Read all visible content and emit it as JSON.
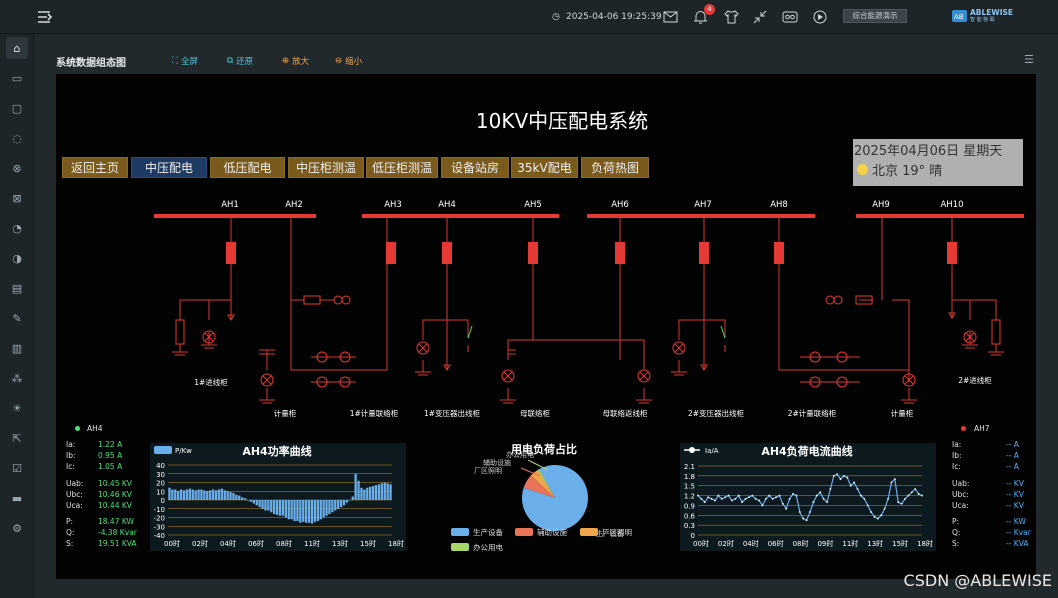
{
  "topbar": {
    "datetime": "2025-04-06 19:25:39",
    "badge": "4",
    "demo_label": "综合能源演示",
    "brand": "ABLEWISE",
    "brand_sub": "智 能 物 联"
  },
  "page": {
    "title": "系统数据组态图",
    "tools": {
      "fullscreen": "全屏",
      "restore": "还原",
      "zoom_in": "放大",
      "zoom_out": "缩小"
    }
  },
  "scada": {
    "title": "10KV中压配电系统",
    "nav": [
      "返回主页",
      "中压配电",
      "低压配电",
      "中压柜测温",
      "低压柜测温",
      "设备站房",
      "35kV配电",
      "负荷热图"
    ],
    "weather": {
      "date": "2025年04月06日 星期天",
      "city_weather": "北京 19° 晴"
    },
    "cabinets": [
      "AH1",
      "AH2",
      "AH3",
      "AH4",
      "AH5",
      "AH6",
      "AH7",
      "AH8",
      "AH9",
      "AH10"
    ],
    "labels": {
      "in1": "1#进线柜",
      "meter1": "计量柜",
      "link1": "1#计量联络柜",
      "tx1": "1#变压器出线柜",
      "bus_tie": "母联络柜",
      "bus_tie_back": "母联络返线柜",
      "tx2": "2#变压器出线柜",
      "link2": "2#计量联络柜",
      "meter2": "计量柜",
      "in2": "2#进线柜"
    }
  },
  "left_meter": {
    "name": "AH4",
    "rows": [
      {
        "k": "Ia:",
        "v": "1.22 A"
      },
      {
        "k": "Ib:",
        "v": "0.95 A"
      },
      {
        "k": "Ic:",
        "v": "1.05 A"
      },
      {
        "k": "Uab:",
        "v": "10.45 KV"
      },
      {
        "k": "Ubc:",
        "v": "10.46 KV"
      },
      {
        "k": "Uca:",
        "v": "10.44 KV"
      },
      {
        "k": "P:",
        "v": "18.47 KW"
      },
      {
        "k": "Q:",
        "v": "-4.38 Kvar"
      },
      {
        "k": "S:",
        "v": "19.51 KVA"
      }
    ]
  },
  "right_meter": {
    "name": "AH7",
    "rows": [
      {
        "k": "Ia:",
        "v": "-- A"
      },
      {
        "k": "Ib:",
        "v": "-- A"
      },
      {
        "k": "Ic:",
        "v": "-- A"
      },
      {
        "k": "Uab:",
        "v": "-- KV"
      },
      {
        "k": "Ubc:",
        "v": "-- KV"
      },
      {
        "k": "Uca:",
        "v": "-- KV"
      },
      {
        "k": "P:",
        "v": "-- KW"
      },
      {
        "k": "Q:",
        "v": "-- Kvar"
      },
      {
        "k": "S:",
        "v": "-- KVA"
      }
    ]
  },
  "chart_data": [
    {
      "type": "bar",
      "title": "AH4功率曲线",
      "legend": "P/Kw",
      "ylim": [
        -40,
        40
      ],
      "yticks": [
        40,
        30,
        20,
        10,
        0,
        -10,
        -20,
        -30,
        -40
      ],
      "xticks": [
        "00时",
        "02时",
        "04时",
        "06时",
        "08时",
        "11时",
        "13时",
        "15时",
        "18时"
      ],
      "values": [
        14,
        12,
        12,
        10,
        12,
        11,
        12,
        13,
        12,
        11,
        12,
        12,
        11,
        10,
        11,
        12,
        11,
        12,
        13,
        11,
        10,
        9,
        8,
        6,
        5,
        3,
        2,
        0,
        -2,
        -4,
        -6,
        -8,
        -10,
        -12,
        -12,
        -14,
        -16,
        -17,
        -18,
        -18,
        -20,
        -22,
        -22,
        -24,
        -24,
        -26,
        -25,
        -26,
        -26,
        -27,
        -25,
        -24,
        -22,
        -20,
        -18,
        -16,
        -14,
        -12,
        -10,
        -8,
        -6,
        -3,
        0,
        4,
        30,
        22,
        14,
        12,
        14,
        15,
        16,
        17,
        18,
        19,
        20,
        19,
        18
      ]
    },
    {
      "type": "pie",
      "title": "用电负荷占比",
      "slices": [
        {
          "name": "生产设备",
          "value": 88,
          "color": "#6aaeea"
        },
        {
          "name": "辅助设施",
          "value": 7,
          "color": "#e8745a"
        },
        {
          "name": "厂区照明",
          "value": 4,
          "color": "#f0a74c"
        },
        {
          "name": "办公用电",
          "value": 1,
          "color": "#a7d66a"
        }
      ]
    },
    {
      "type": "line",
      "title": "AH4负荷电流曲线",
      "legend": "Ia/A",
      "ylim": [
        0,
        2.1
      ],
      "yticks": [
        "2.1",
        "1.8",
        "1.5",
        "1.2",
        "0.9",
        "0.6",
        "0.3",
        "0"
      ],
      "xticks": [
        "00时",
        "02时",
        "04时",
        "06时",
        "08时",
        "09时",
        "11时",
        "13时",
        "15时",
        "18时"
      ],
      "values": [
        1.2,
        1.1,
        1.0,
        1.15,
        1.1,
        1.05,
        1.2,
        1.1,
        1.15,
        1.2,
        1.05,
        1.1,
        1.2,
        1.0,
        1.1,
        1.15,
        1.2,
        1.1,
        1.05,
        0.9,
        1.1,
        1.2,
        1.1,
        1.15,
        1.2,
        0.95,
        0.8,
        1.1,
        1.25,
        1.2,
        0.7,
        0.5,
        0.45,
        0.7,
        1.0,
        1.2,
        1.3,
        1.1,
        1.0,
        1.4,
        1.8,
        1.85,
        1.7,
        1.8,
        1.75,
        1.5,
        1.6,
        1.4,
        1.2,
        1.1,
        0.9,
        0.7,
        0.55,
        0.5,
        0.6,
        0.8,
        1.1,
        1.6,
        1.7,
        1.0,
        0.95,
        1.1,
        1.2,
        1.3,
        1.4,
        1.25,
        1.2
      ]
    }
  ],
  "watermark": "CSDN @ABLEWISE",
  "colors": {
    "bus": "#e53935",
    "breaker": "#e53935",
    "accent_green": "#42e27a",
    "accent_blue": "#4db0ff"
  }
}
